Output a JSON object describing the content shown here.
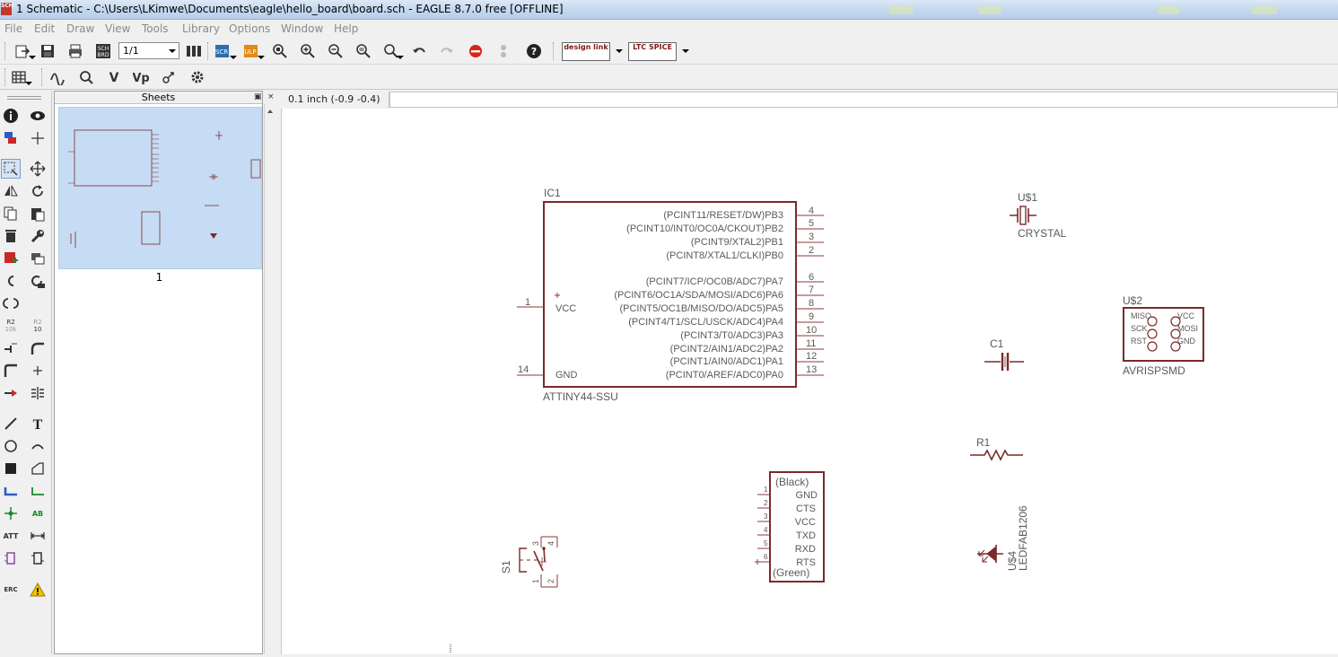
{
  "window": {
    "title": "1 Schematic - C:\\Users\\LKimwe\\Documents\\eagle\\hello_board\\board.sch - EAGLE 8.7.0 free [OFFLINE]",
    "icon_text": "SCH"
  },
  "menu": [
    "File",
    "Edit",
    "Draw",
    "View",
    "Tools",
    "Library",
    "Options",
    "Window",
    "Help"
  ],
  "toolbar": {
    "sheet_select": "1/1",
    "sch_brd_label": "SCH BRD",
    "scr_label": "SCR",
    "ulp_label": "ULP",
    "design_link_label": "design link",
    "ltc_spice_label": "LTC SPICE"
  },
  "palette_labels": {
    "r2_a": "R2",
    "r2_a_sub": "10k",
    "r2_b": "R2",
    "r2_b_sub": "10",
    "text_tool": "T",
    "erc": "ERC",
    "ab": "AB",
    "att": "ATT"
  },
  "sheets": {
    "title": "Sheets",
    "items": [
      {
        "label": "1"
      }
    ]
  },
  "status": {
    "coordinate": "0.1 inch (-0.9 -0.4)"
  },
  "schematic": {
    "ic1": {
      "name": "IC1",
      "value": "ATTINY44-SSU",
      "left_pins": [
        {
          "num": "1",
          "name": "VCC"
        },
        {
          "num": "14",
          "name": "GND"
        }
      ],
      "right_pins": [
        {
          "name": "(PCINT11/RESET/DW)PB3",
          "num": "4"
        },
        {
          "name": "(PCINT10/INT0/OC0A/CKOUT)PB2",
          "num": "5"
        },
        {
          "name": "(PCINT9/XTAL2)PB1",
          "num": "3"
        },
        {
          "name": "(PCINT8/XTAL1/CLKI)PB0",
          "num": "2"
        },
        {
          "name": "(PCINT7/ICP/OC0B/ADC7)PA7",
          "num": "6"
        },
        {
          "name": "(PCINT6/OC1A/SDA/MOSI/ADC6)PA6",
          "num": "7"
        },
        {
          "name": "(PCINT5/OC1B/MISO/DO/ADC5)PA5",
          "num": "8"
        },
        {
          "name": "(PCINT4/T1/SCL/USCK/ADC4)PA4",
          "num": "9"
        },
        {
          "name": "(PCINT3/T0/ADC3)PA3",
          "num": "10"
        },
        {
          "name": "(PCINT2/AIN1/ADC2)PA2",
          "num": "11"
        },
        {
          "name": "(PCINT1/AIN0/ADC1)PA1",
          "num": "12"
        },
        {
          "name": "(PCINT0/AREF/ADC0)PA0",
          "num": "13"
        }
      ]
    },
    "u1": {
      "name": "U$1",
      "value": "CRYSTAL"
    },
    "u2": {
      "name": "U$2",
      "value": "AVRISPSMD",
      "left": [
        "MISO",
        "SCK",
        "RST"
      ],
      "right": [
        "VCC",
        "MOSI",
        "GND"
      ]
    },
    "c1": {
      "name": "C1"
    },
    "r1": {
      "name": "R1"
    },
    "u4": {
      "name": "U$4",
      "value": "LEDFAB1206"
    },
    "s1": {
      "name": "S1",
      "pins": [
        "3",
        "4",
        "1",
        "2"
      ]
    },
    "ftdi": {
      "top": "(Black)",
      "bottom": "(Green)",
      "pins": [
        {
          "num": "1",
          "name": "GND"
        },
        {
          "num": "2",
          "name": "CTS"
        },
        {
          "num": "3",
          "name": "VCC"
        },
        {
          "num": "4",
          "name": "TXD"
        },
        {
          "num": "5",
          "name": "RXD"
        },
        {
          "num": "6",
          "name": "RTS"
        }
      ]
    }
  },
  "colors": {
    "symbol": "#7a2a2a",
    "pin": "#8b3a3a",
    "selection": "#c6dcf4"
  }
}
